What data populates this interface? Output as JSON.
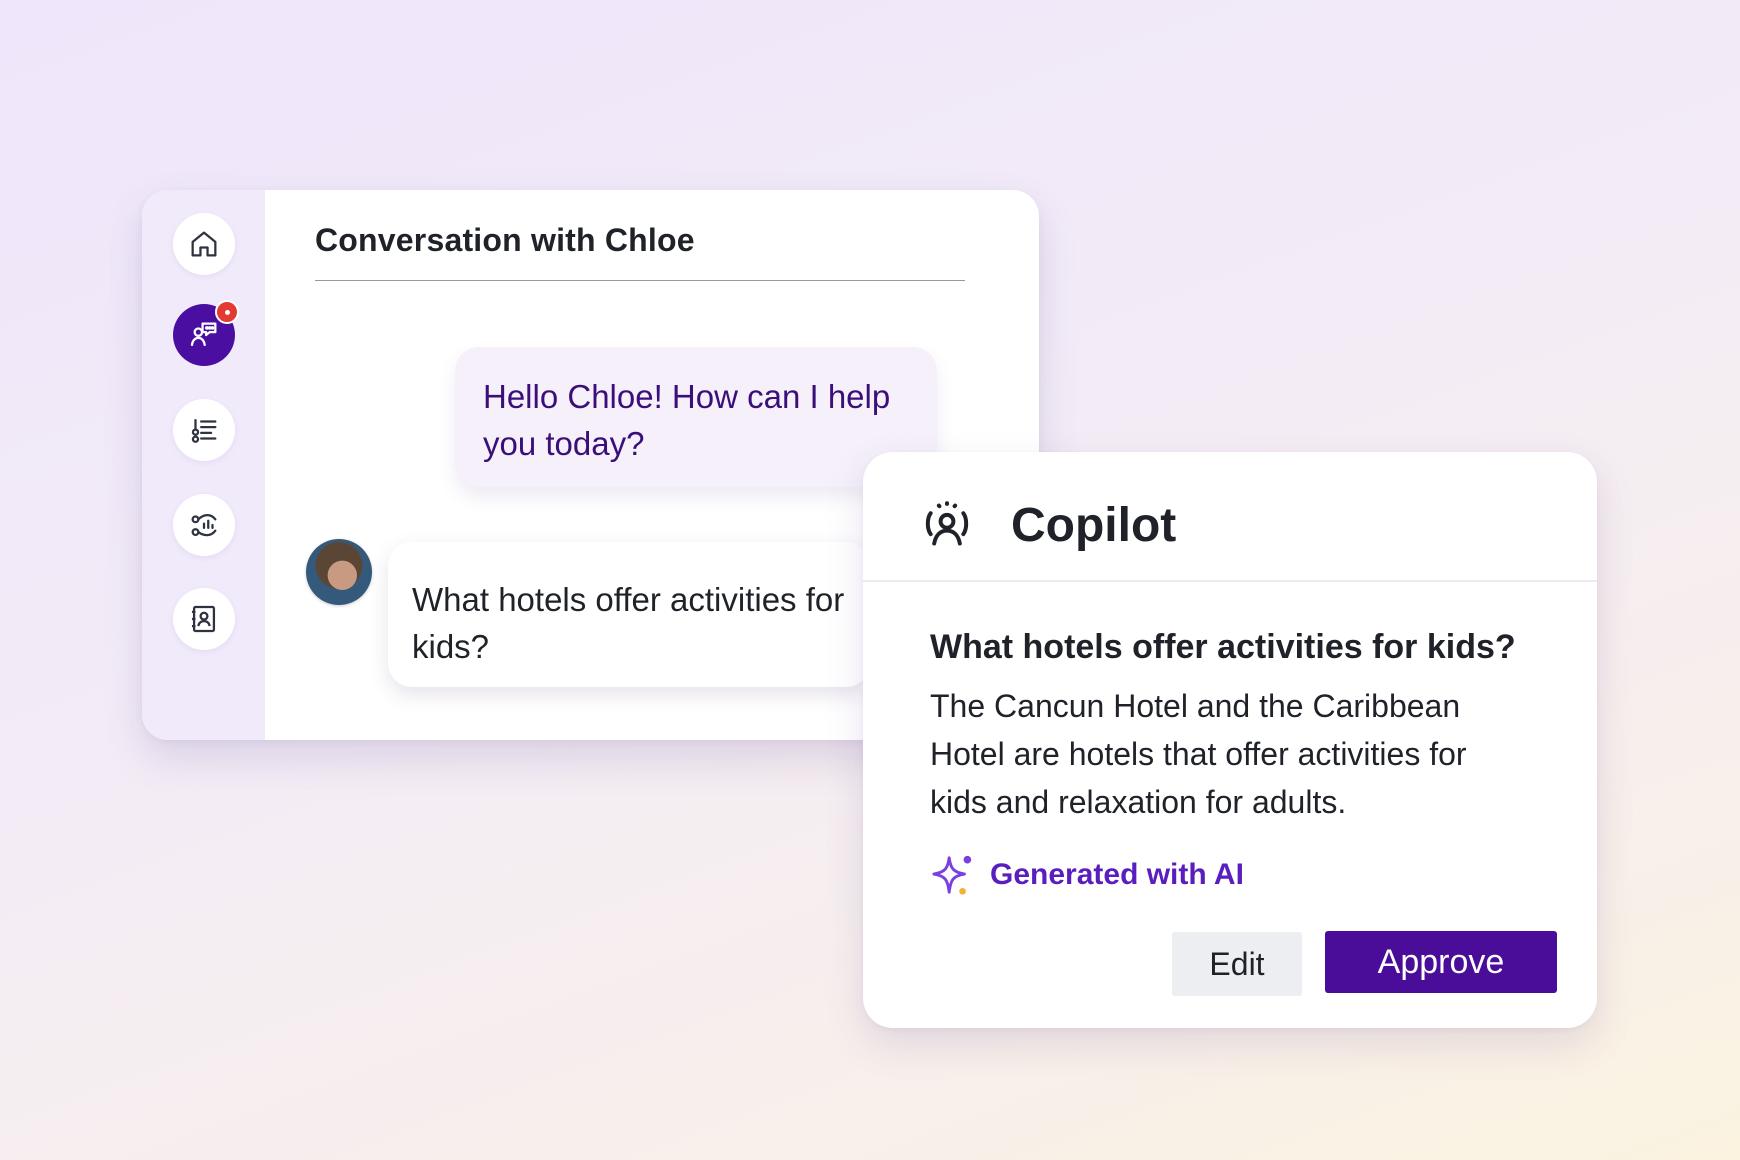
{
  "conversation": {
    "title": "Conversation with Chloe",
    "agent_message": "Hello Chloe! How can I help you today?",
    "user_message": "What hotels offer activities for kids?"
  },
  "sidebar": {
    "items": [
      {
        "name": "home",
        "icon": "home-icon",
        "active": false
      },
      {
        "name": "conversations",
        "icon": "chat-person-icon",
        "active": true,
        "has_notification": true
      },
      {
        "name": "tasks",
        "icon": "list-icon",
        "active": false
      },
      {
        "name": "analytics",
        "icon": "analytics-icon",
        "active": false
      },
      {
        "name": "contacts",
        "icon": "contact-book-icon",
        "active": false
      }
    ]
  },
  "copilot": {
    "title": "Copilot",
    "question": "What hotels offer activities for kids?",
    "answer": "The Cancun Hotel and the Caribbean Hotel are hotels that offer activities for kids and relaxation for adults.",
    "ai_label": "Generated with AI",
    "edit_label": "Edit",
    "approve_label": "Approve"
  },
  "colors": {
    "brand_purple": "#4a0d99",
    "notification_red": "#e33a32",
    "sidebar_bg": "#f1eafb",
    "ai_label": "#5a1ebf"
  }
}
